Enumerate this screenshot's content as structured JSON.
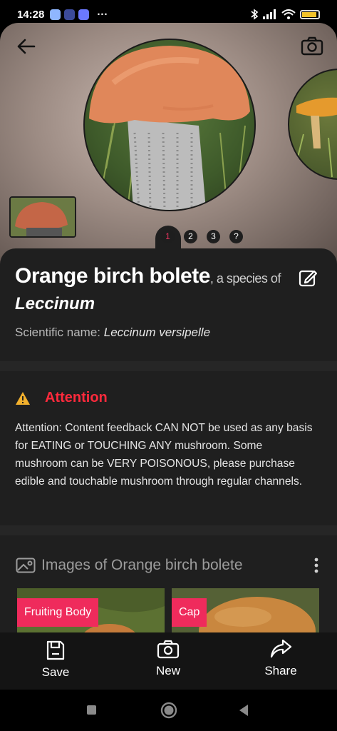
{
  "status_bar": {
    "time": "14:28",
    "dots": "···"
  },
  "hero": {
    "pager": [
      "1",
      "2",
      "3",
      "?"
    ]
  },
  "species": {
    "common_name": "Orange birch bolete",
    "species_of": ", a species of",
    "genus": "Leccinum",
    "scientific_label": "Scientific name: ",
    "scientific_name": "Leccinum versipelle"
  },
  "attention": {
    "title": "Attention",
    "text": "Attention: Content feedback CAN NOT be used as any basis for EATING or TOUCHING ANY mushroom. Some mushroom can be VERY POISONOUS, please purchase edible and touchable mushroom through regular channels."
  },
  "images": {
    "title": "Images of Orange birch bolete",
    "cards": [
      "Fruiting Body",
      "Cap"
    ]
  },
  "bottom_nav": {
    "save": "Save",
    "new": "New",
    "share": "Share"
  },
  "colors": {
    "accent": "#ef2b5c",
    "attention": "#ff2a3c",
    "sheet": "#1f1f1f"
  }
}
